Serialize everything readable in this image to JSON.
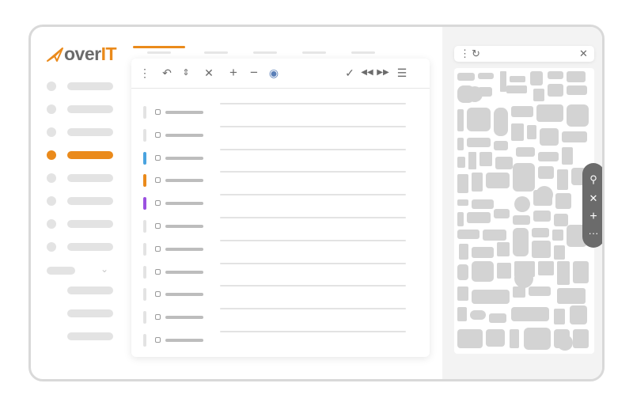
{
  "app": {
    "logo_main": "over",
    "logo_accent": "IT",
    "brand_color": "#ea8a1b"
  },
  "sidebar": {
    "items": [
      {
        "active": false
      },
      {
        "active": false
      },
      {
        "active": false
      },
      {
        "active": true
      },
      {
        "active": false
      },
      {
        "active": false
      },
      {
        "active": false
      },
      {
        "active": false
      }
    ],
    "group_expanded": false,
    "sub_items": 3
  },
  "tabs": [
    {
      "active": true
    },
    {
      "active": false
    },
    {
      "active": false
    },
    {
      "active": false
    },
    {
      "active": false
    }
  ],
  "toolbar": {
    "icons": [
      "more-vertical-icon",
      "undo-icon",
      "sort-icon",
      "close-icon",
      "plus-icon",
      "minus-icon",
      "globe-icon",
      "check-icon",
      "rewind-icon",
      "fast-forward-icon",
      "menu-icon"
    ]
  },
  "list": {
    "rows": [
      {
        "color": "#e3e3e3"
      },
      {
        "color": "#e3e3e3"
      },
      {
        "color": "#4aa3df"
      },
      {
        "color": "#ea8a1b"
      },
      {
        "color": "#9b51e0"
      },
      {
        "color": "#e3e3e3"
      },
      {
        "color": "#e3e3e3"
      },
      {
        "color": "#e3e3e3"
      },
      {
        "color": "#e3e3e3"
      },
      {
        "color": "#e3e3e3"
      },
      {
        "color": "#e3e3e3"
      }
    ]
  },
  "map_panel": {
    "header_icons": [
      "more-vertical-icon",
      "refresh-icon",
      "close-icon"
    ],
    "tools": [
      "search-icon",
      "close-icon",
      "plus-icon",
      "more-horizontal-icon"
    ]
  }
}
